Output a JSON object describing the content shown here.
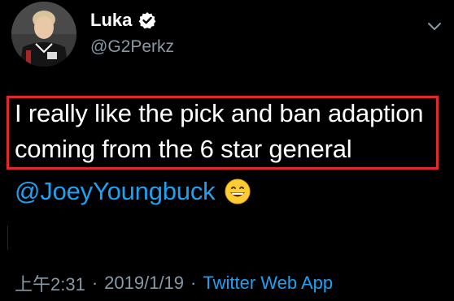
{
  "tweet": {
    "author": {
      "display_name": "Luka",
      "handle": "@G2Perkz",
      "verified_icon": "verified-badge-icon"
    },
    "text_line1": "I really like the pick and ban adaption",
    "text_line2": "coming from the 6 star general",
    "mention": "@JoeyYoungbuck",
    "emoji": "grinning-face-emoji",
    "time": "上午2:31",
    "separator": "·",
    "date": "2019/1/19",
    "source": "Twitter Web App"
  },
  "colors": {
    "background": "#000000",
    "primary_text": "#ffffff",
    "secondary_text": "#8899a6",
    "link": "#1da1f2",
    "highlight_border": "#e3282c"
  },
  "icons": {
    "menu": "chevron-down-icon"
  }
}
